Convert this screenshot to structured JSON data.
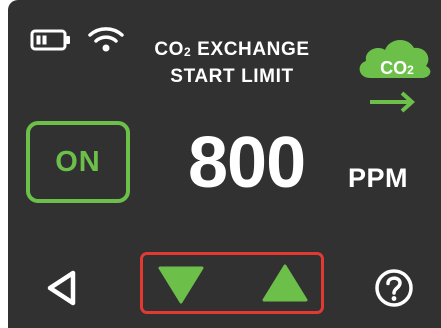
{
  "status": {
    "battery_icon": "battery-icon",
    "wifi_icon": "wifi-icon"
  },
  "title": {
    "line1_prefix": "CO",
    "line1_sub": "2",
    "line1_suffix": " EXCHANGE",
    "line2": "START LIMIT"
  },
  "cloud_badge": {
    "icon": "co2-cloud-icon",
    "label_prefix": "CO",
    "label_sub": "2",
    "arrow_icon": "arrow-right-icon"
  },
  "toggle": {
    "label": "ON"
  },
  "reading": {
    "value": "800",
    "unit": "PPM"
  },
  "controls": {
    "back_icon": "back-triangle-icon",
    "decrease_icon": "down-triangle-icon",
    "increase_icon": "up-triangle-icon",
    "help_icon": "help-icon"
  },
  "colors": {
    "background": "#313131",
    "accent_green": "#6cc04a",
    "highlight_red": "#e23a32",
    "text": "#ffffff"
  }
}
